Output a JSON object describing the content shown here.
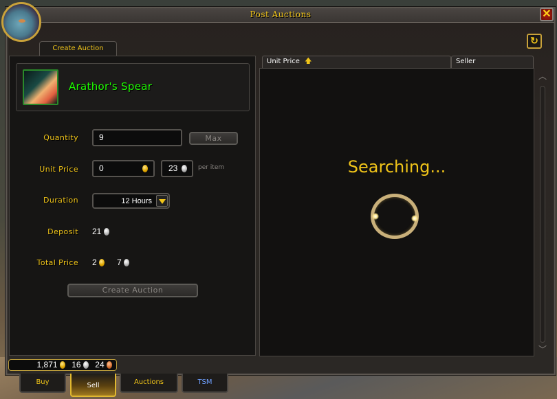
{
  "window": {
    "title": "Post Auctions",
    "close_icon": "close-x-icon",
    "refresh_icon": "refresh-icon"
  },
  "tabs_top": [
    {
      "label": "Create Auction",
      "active": true
    }
  ],
  "item": {
    "name": "Arathor's Spear",
    "quality_color": "#1eff00",
    "icon": "spear-item-icon"
  },
  "form": {
    "quantity_label": "Quantity",
    "quantity_value": "9",
    "max_label": "Max",
    "unit_price_label": "Unit Price",
    "unit_price_gold": "0",
    "unit_price_silver": "23",
    "per_item_label": "per item",
    "duration_label": "Duration",
    "duration_value": "12 Hours",
    "deposit_label": "Deposit",
    "deposit_silver": "21",
    "total_price_label": "Total Price",
    "total_gold": "2",
    "total_silver": "7",
    "create_button": "Create Auction"
  },
  "results": {
    "columns": [
      {
        "label": "Unit Price",
        "sort": "ascending"
      },
      {
        "label": "Seller"
      }
    ],
    "status": "Searching..."
  },
  "money": {
    "gold": "1,871",
    "silver": "16",
    "copper": "24"
  },
  "bottom_tabs": [
    {
      "label": "Buy",
      "color": "#f0c419",
      "active": false
    },
    {
      "label": "Sell",
      "color": "#ffffff",
      "active": true
    },
    {
      "label": "Auctions",
      "color": "#f0c419",
      "active": false
    },
    {
      "label": "TSM",
      "color": "#6fa0ff",
      "active": false
    }
  ],
  "colors": {
    "accent_gold": "#f0c419",
    "item_green": "#1eff00"
  }
}
